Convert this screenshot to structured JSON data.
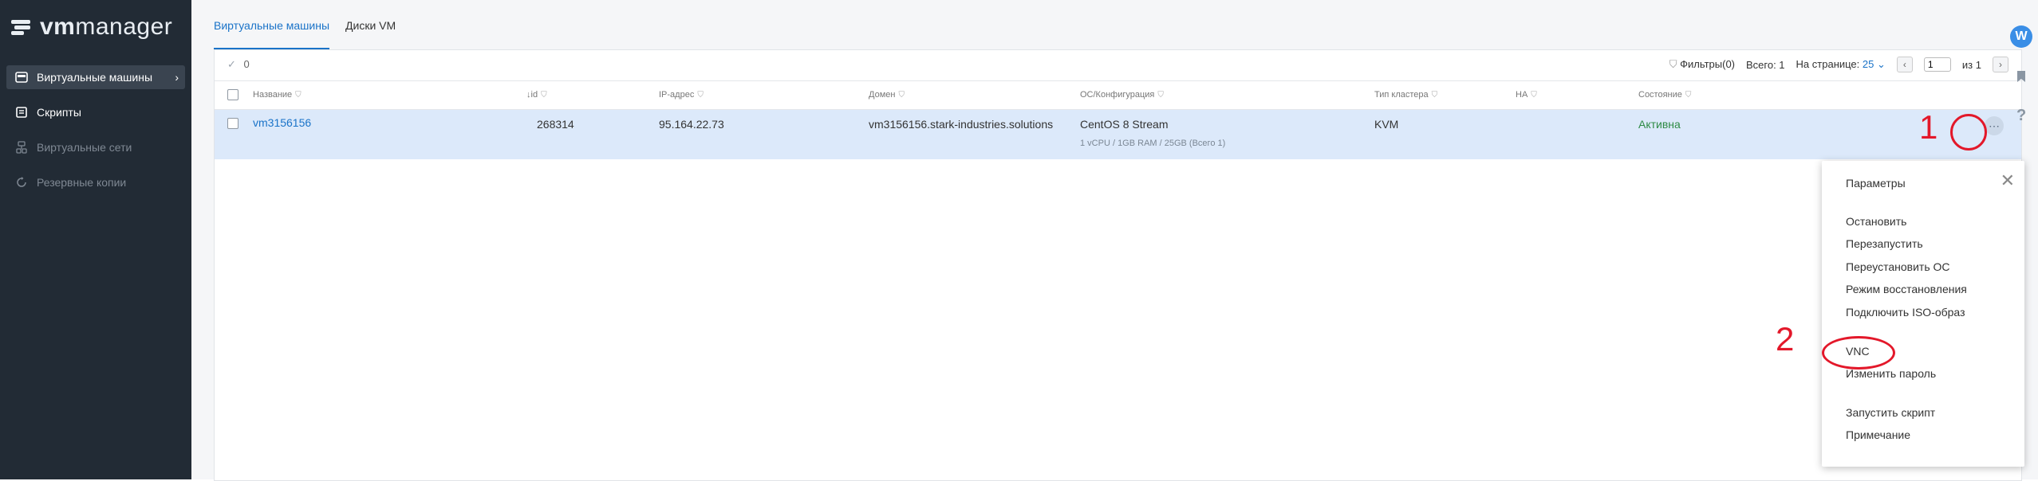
{
  "app": {
    "brand_vm": "vm",
    "brand_manager": "manager"
  },
  "sidebar": {
    "items": [
      {
        "label": "Виртуальные машины",
        "icon": "server-icon"
      },
      {
        "label": "Скрипты",
        "icon": "script-icon"
      },
      {
        "label": "Виртуальные сети",
        "icon": "network-icon"
      },
      {
        "label": "Резервные копии",
        "icon": "backup-icon"
      }
    ]
  },
  "tabs": [
    {
      "label": "Виртуальные машины"
    },
    {
      "label": "Диски VM"
    }
  ],
  "toolbar": {
    "selected_count": "0",
    "filters": "Фильтры(0)",
    "total": "Всего: 1",
    "per_page_label": "На странице:",
    "per_page_value": "25",
    "page_value": "1",
    "of_label": "из",
    "total_pages": "1"
  },
  "columns": {
    "name": "Название",
    "id": "id",
    "ip": "IP-адрес",
    "domain": "Домен",
    "os": "ОС/Конфигурация",
    "cluster": "Тип кластера",
    "ha": "HA",
    "state": "Состояние"
  },
  "rows": [
    {
      "name": "vm3156156",
      "id": "268314",
      "ip": "95.164.22.73",
      "domain": "vm3156156.stark-industries.solutions",
      "os": "CentOS 8 Stream",
      "config": "1 vCPU / 1GB RAM / 25GB (Всего 1)",
      "cluster": "KVM",
      "state": "Активна"
    }
  ],
  "menu": {
    "items": [
      "Параметры",
      "Остановить",
      "Перезапустить",
      "Переустановить ОС",
      "Режим восстановления",
      "Подключить ISO-образ",
      "VNC",
      "Изменить пароль",
      "Запустить скрипт",
      "Примечание"
    ]
  },
  "annotations": {
    "one": "1",
    "two": "2"
  },
  "user": {
    "initial": "W"
  },
  "colors": {
    "accent": "#1a73c8",
    "sidebar": "#222b35",
    "selected_row": "#dce9fa",
    "annotation": "#e3182a",
    "status_active": "#2e8b45"
  }
}
